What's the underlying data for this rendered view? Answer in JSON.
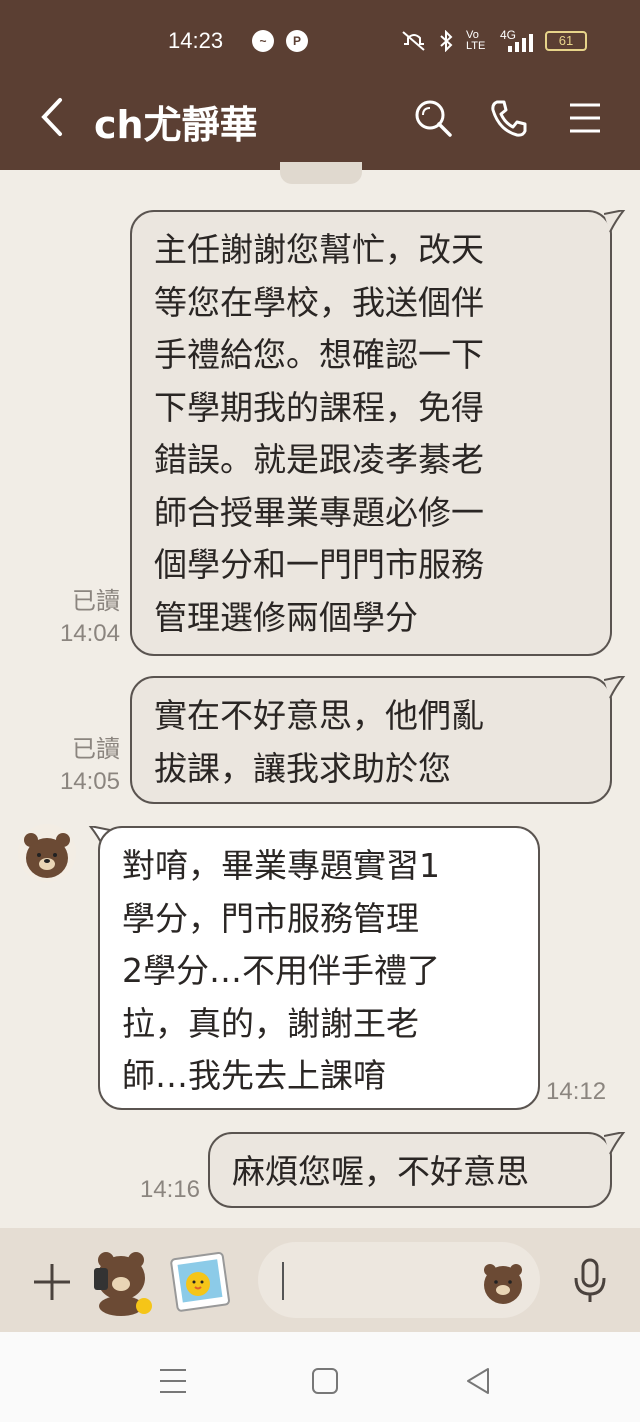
{
  "status_bar": {
    "time": "14:23",
    "network": "4G",
    "volte": "Vo LTE",
    "battery": "61"
  },
  "header": {
    "title": "ch尤靜華"
  },
  "messages": [
    {
      "sender": "me",
      "lines": [
        "主任謝謝您幫忙，改天",
        "等您在學校，我送個伴",
        "手禮給您。想確認一下",
        "下學期我的課程，免得",
        "錯誤。就是跟凌孝綦老",
        "師合授畢業專題必修一",
        "個學分和一門門市服務",
        "管理選修兩個學分"
      ],
      "read": "已讀",
      "time": "14:04"
    },
    {
      "sender": "me",
      "lines": [
        "實在不好意思，他們亂",
        "拔課，讓我求助於您"
      ],
      "read": "已讀",
      "time": "14:05"
    },
    {
      "sender": "them",
      "lines": [
        "對唷，畢業專題實習1",
        "學分，門市服務管理",
        "2學分…不用伴手禮了",
        "拉，真的，謝謝王老",
        "師…我先去上課唷"
      ],
      "time": "14:12"
    },
    {
      "sender": "me",
      "lines": [
        "麻煩您喔，不好意思"
      ],
      "time": "14:16"
    }
  ],
  "input": {
    "placeholder": ""
  },
  "colors": {
    "header_bg": "#5b3f33",
    "chat_bg": "#f1ede6",
    "my_bubble": "#ebe6df",
    "their_bubble": "#ffffff",
    "input_bar": "#e5ddd3"
  },
  "icons": [
    "back-arrow-icon",
    "search-icon",
    "phone-icon",
    "menu-icon",
    "plus-icon",
    "bear-sticker-icon",
    "photo-sticker-icon",
    "emoji-bear-icon",
    "microphone-icon",
    "nav-recent-icon",
    "nav-home-icon",
    "nav-back-icon"
  ]
}
